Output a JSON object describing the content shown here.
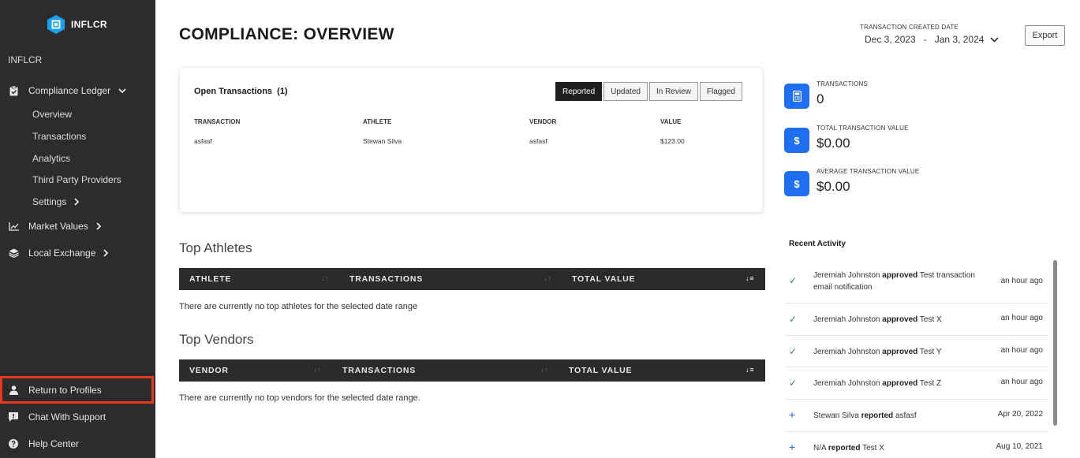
{
  "brand": {
    "logo_text": "INFLCR",
    "org_name": "INFLCR",
    "accent": "#1e6ff1"
  },
  "sidebar": {
    "ledger": {
      "label": "Compliance Ledger",
      "icon": "clipboard-icon"
    },
    "ledger_items": [
      "Overview",
      "Transactions",
      "Analytics",
      "Third Party Providers",
      "Settings"
    ],
    "market_values": {
      "label": "Market Values",
      "icon": "line-chart-icon"
    },
    "local_exchange": {
      "label": "Local Exchange",
      "icon": "layers-icon"
    },
    "return_profiles": {
      "label": "Return to Profiles",
      "icon": "user-icon"
    },
    "chat_support": {
      "label": "Chat With Support",
      "icon": "chat-icon"
    },
    "help_center": {
      "label": "Help Center",
      "icon": "help-icon"
    }
  },
  "header": {
    "title": "COMPLIANCE: OVERVIEW",
    "date_label": "TRANSACTION CREATED DATE",
    "date_from": "Dec 3, 2023",
    "date_sep": "-",
    "date_to": "Jan 3, 2024",
    "export_label": "Export"
  },
  "open_transactions": {
    "title": "Open Transactions",
    "count": "(1)",
    "filters": [
      "Reported",
      "Updated",
      "In Review",
      "Flagged"
    ],
    "active_filter": "Reported",
    "columns": [
      "TRANSACTION",
      "ATHLETE",
      "VENDOR",
      "VALUE"
    ],
    "rows": [
      [
        "asfasf",
        "Stewan Silva",
        "asfasf",
        "$123.00"
      ]
    ]
  },
  "stats": [
    {
      "label": "TRANSACTIONS",
      "value": "0",
      "icon": "calculator-icon"
    },
    {
      "label": "TOTAL TRANSACTION VALUE",
      "value": "$0.00",
      "icon": "dollar-icon"
    },
    {
      "label": "AVERAGE TRANSACTION VALUE",
      "value": "$0.00",
      "icon": "dollar-icon"
    }
  ],
  "top_athletes": {
    "title": "Top Athletes",
    "columns": [
      "ATHLETE",
      "TRANSACTIONS",
      "TOTAL VALUE"
    ],
    "empty": "There are currently no top athletes for the selected date range"
  },
  "top_vendors": {
    "title": "Top Vendors",
    "columns": [
      "VENDOR",
      "TRANSACTIONS",
      "TOTAL VALUE"
    ],
    "empty": "There are currently no top vendors for the selected date range."
  },
  "recent_activity": {
    "title": "Recent Activity",
    "items": [
      {
        "mark": "check",
        "actor": "Jeremiah Johnston",
        "action": "approved",
        "target": "Test transaction email notification",
        "time": "an hour ago"
      },
      {
        "mark": "check",
        "actor": "Jeremiah Johnston",
        "action": "approved",
        "target": "Test X",
        "time": "an hour ago"
      },
      {
        "mark": "check",
        "actor": "Jeremiah Johnston",
        "action": "approved",
        "target": "Test Y",
        "time": "an hour ago"
      },
      {
        "mark": "check",
        "actor": "Jeremiah Johnston",
        "action": "approved",
        "target": "Test Z",
        "time": "an hour ago"
      },
      {
        "mark": "plus",
        "actor": "Stewan Silva",
        "action": "reported",
        "target": "asfasf",
        "time": "Apr 20, 2022"
      },
      {
        "mark": "plus",
        "actor": "N/A",
        "action": "reported",
        "target": "Test X",
        "time": "Aug 10, 2021"
      }
    ]
  }
}
